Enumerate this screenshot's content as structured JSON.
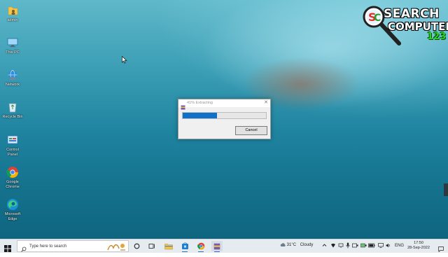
{
  "desktop_icons": [
    {
      "label": "admin",
      "icon": "user-folder-icon"
    },
    {
      "label": "This PC",
      "icon": "this-pc-icon"
    },
    {
      "label": "Network",
      "icon": "network-icon"
    },
    {
      "label": "Recycle Bin",
      "icon": "recycle-bin-icon"
    },
    {
      "label": "Control Panel",
      "icon": "control-panel-icon"
    },
    {
      "label": "Google Chrome",
      "icon": "chrome-icon"
    },
    {
      "label": "Microsoft Edge",
      "icon": "edge-icon"
    }
  ],
  "watermark": {
    "line1": "SEARCH",
    "line2": "COMPUTER",
    "line3": "123"
  },
  "dialog": {
    "title": "41% Extracting",
    "progress_percent": 41,
    "cancel_label": "Cancel"
  },
  "taskbar": {
    "search_placeholder": "Type here to search",
    "weather_temp": "31°C",
    "weather_text": "Cloudy",
    "language": "ENG",
    "time": "17:50",
    "date": "28-Sep-2022",
    "accent_color": "#0f72c8"
  }
}
